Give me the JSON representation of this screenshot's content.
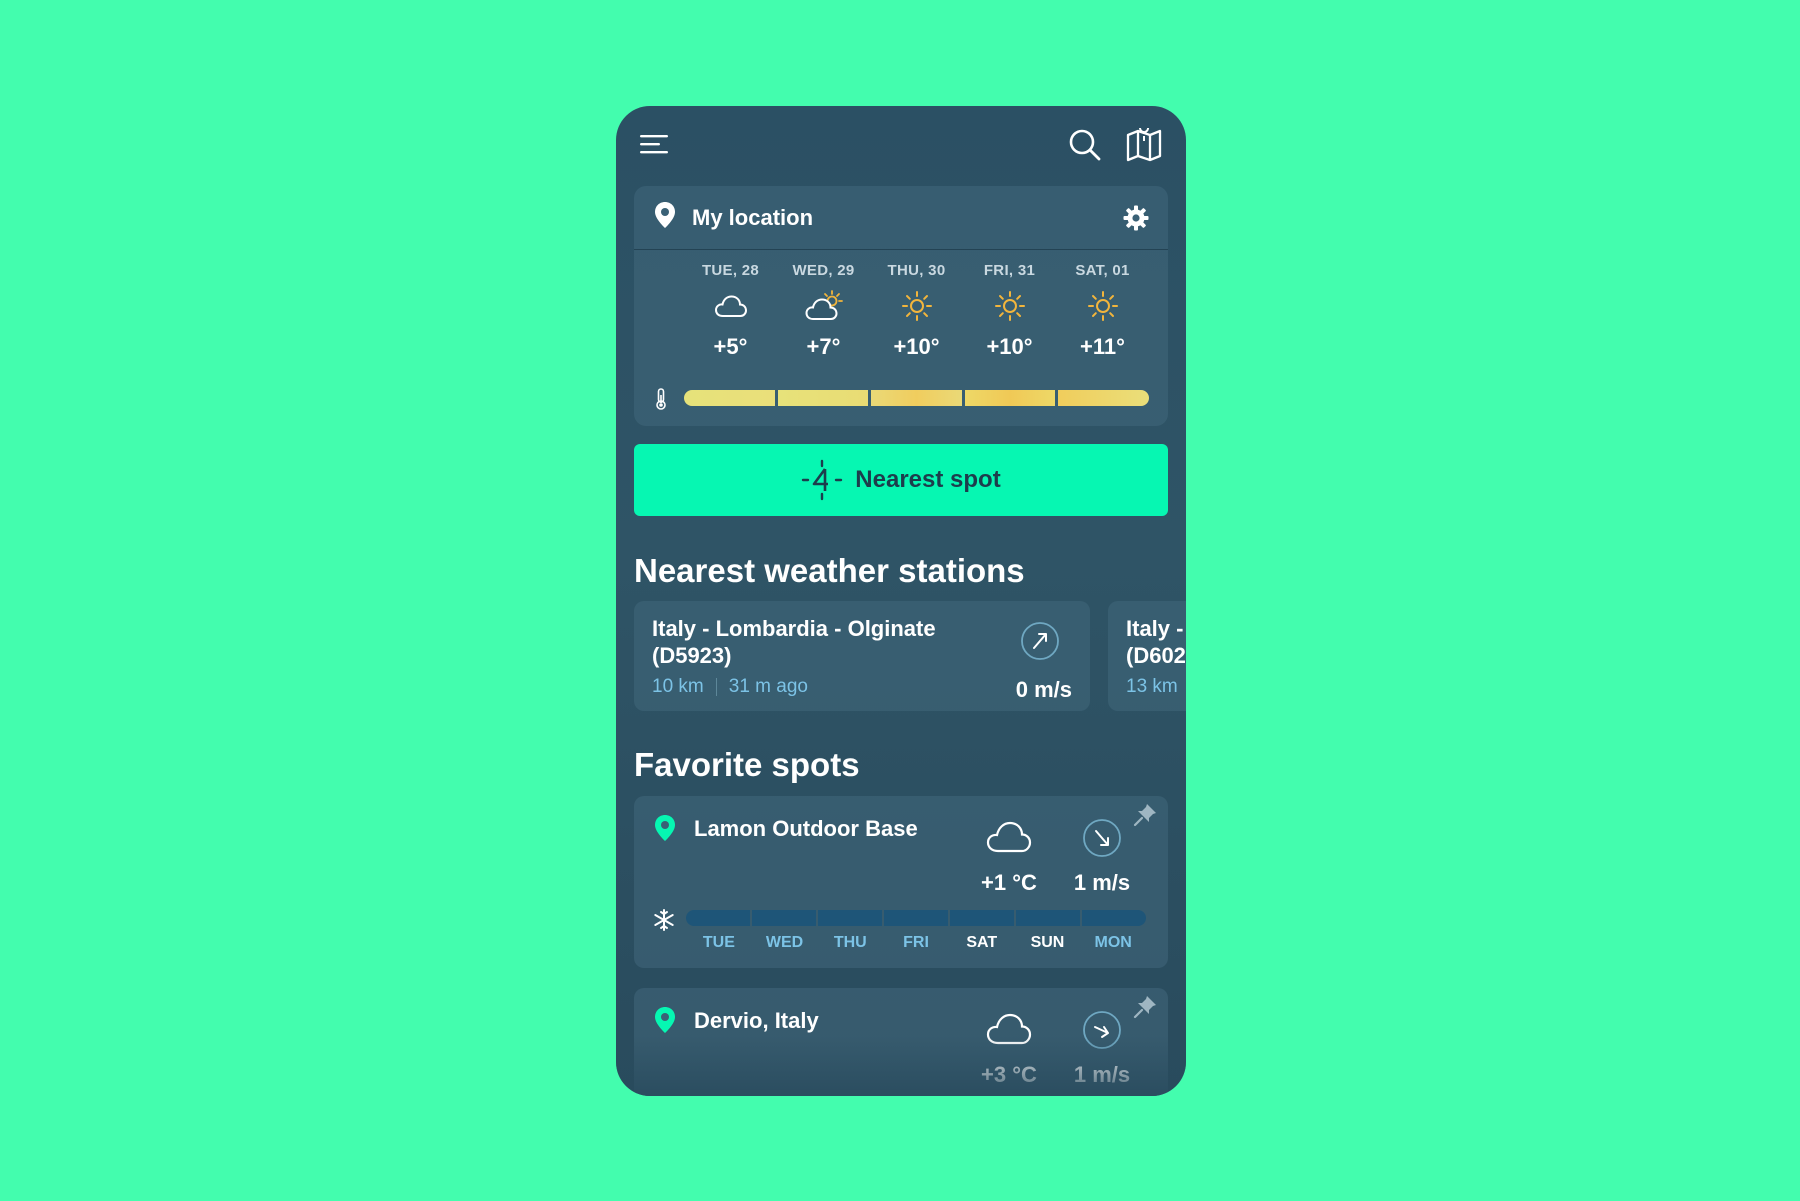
{
  "colors": {
    "background": "#43fdae",
    "accent": "#06f7b2",
    "sun": "#f2b53c",
    "wind_label_light": "#7cc3e6"
  },
  "topbar": {
    "menu_icon": "hamburger-menu-icon",
    "search_icon": "search-icon",
    "map_icon": "map-icon"
  },
  "location": {
    "title": "My location",
    "pin_icon": "location-pin-icon",
    "settings_icon": "gear-icon",
    "thermometer_icon": "thermometer-icon",
    "days": [
      {
        "label": "TUE, 28",
        "icon": "cloud-icon",
        "temp": "+5°"
      },
      {
        "label": "WED, 29",
        "icon": "partly-sunny-icon",
        "temp": "+7°"
      },
      {
        "label": "THU, 30",
        "icon": "sun-icon",
        "temp": "+10°"
      },
      {
        "label": "FRI, 31",
        "icon": "sun-icon",
        "temp": "+10°"
      },
      {
        "label": "SAT, 01",
        "icon": "sun-icon",
        "temp": "+11°"
      }
    ]
  },
  "nearest_spot": {
    "label": "Nearest spot",
    "icon": "kitesurfer-target-icon"
  },
  "stations": {
    "title": "Nearest weather stations",
    "items": [
      {
        "name": "Italy - Lombardia - Olginate",
        "code": "(D5923)",
        "distance": "10 km",
        "age": "31 m ago",
        "speed": "0 m/s"
      },
      {
        "name": "Italy -",
        "code": "(D602",
        "distance": "13 km",
        "age": "",
        "speed": ""
      }
    ]
  },
  "favorites": {
    "title": "Favorite spots",
    "items": [
      {
        "name": "Lamon Outdoor Base",
        "temp": "+1 °C",
        "wind": "1 m/s",
        "weekdays": [
          {
            "label": "TUE",
            "color": "#7cc3e6"
          },
          {
            "label": "WED",
            "color": "#7cc3e6"
          },
          {
            "label": "THU",
            "color": "#7cc3e6"
          },
          {
            "label": "FRI",
            "color": "#7cc3e6"
          },
          {
            "label": "SAT",
            "color": "#ffffff"
          },
          {
            "label": "SUN",
            "color": "#ffffff"
          },
          {
            "label": "MON",
            "color": "#7cc3e6"
          }
        ]
      },
      {
        "name": "Dervio, Italy",
        "temp": "+3 °C",
        "wind": "1 m/s"
      }
    ]
  }
}
